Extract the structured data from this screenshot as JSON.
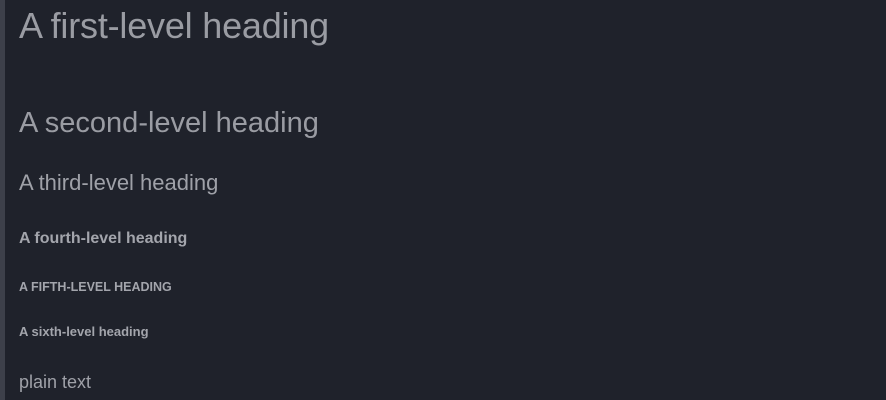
{
  "document": {
    "h1": "A first-level heading",
    "h2": "A second-level heading",
    "h3": "A third-level heading",
    "h4": "A fourth-level heading",
    "h5": "A FIFTH-LEVEL HEADING",
    "h6": "A sixth-level heading",
    "plain_text": "plain text"
  },
  "colors": {
    "background": "#1f222b",
    "text": "#9a9ca3",
    "left_rule": "#3d404a"
  }
}
